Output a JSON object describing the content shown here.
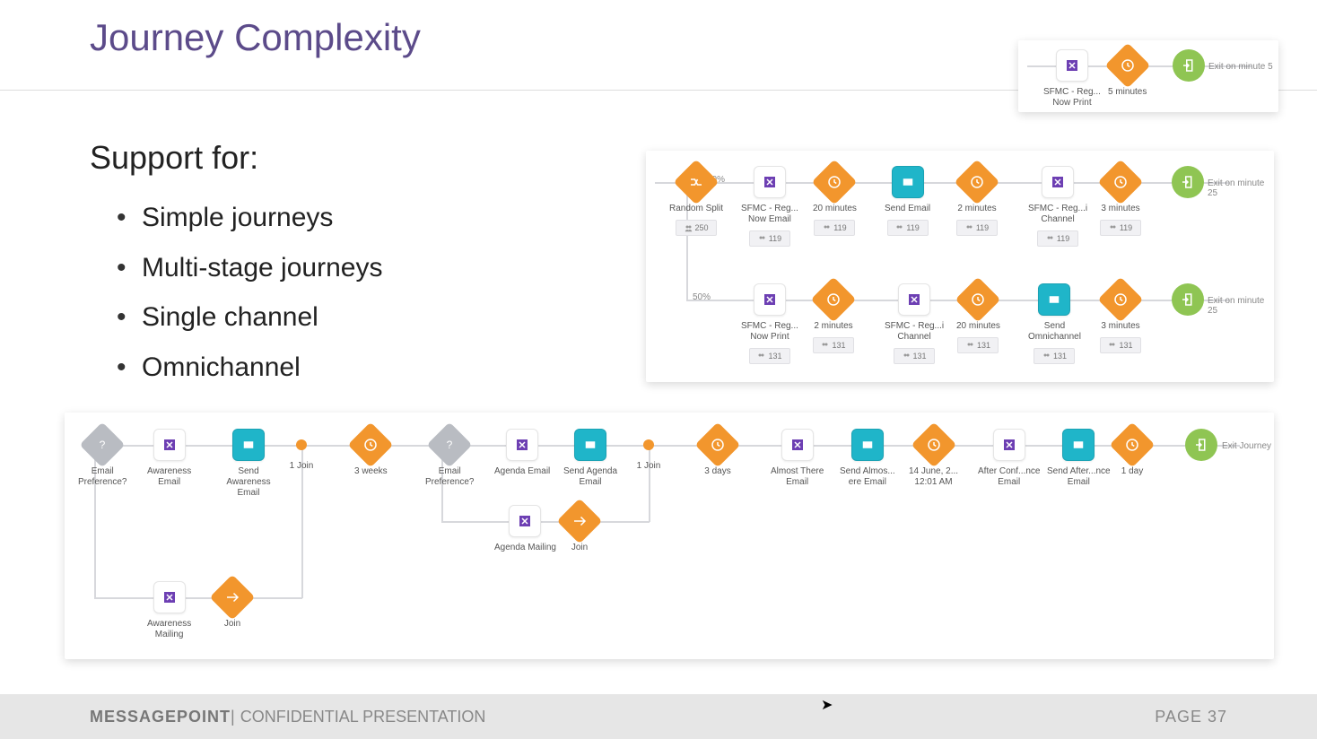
{
  "title": "Journey Complexity",
  "support_heading": "Support for:",
  "bullets": [
    "Simple journeys",
    "Multi-stage journeys",
    "Single channel",
    "Omnichannel"
  ],
  "footer": {
    "brand": "MESSAGEPOINT",
    "separator": " | ",
    "conf": "CONFIDENTIAL PRESENTATION",
    "page": "PAGE  37"
  },
  "panel1": {
    "n1": {
      "label": "SFMC - Reg...\nNow Print"
    },
    "n2": {
      "label": "5 minutes"
    },
    "n3": {
      "side": "Exit on minute 5"
    }
  },
  "panel2": {
    "percent_top": "50%",
    "percent_bot": "50%",
    "rowA": [
      {
        "label": "Random Split",
        "badge": "250"
      },
      {
        "label": "SFMC - Reg...\nNow Email",
        "badge": "119"
      },
      {
        "label": "20 minutes",
        "badge": "119"
      },
      {
        "label": "Send Email",
        "badge": "119"
      },
      {
        "label": "2 minutes",
        "badge": "119"
      },
      {
        "label": "SFMC - Reg...i\nChannel",
        "badge": "119"
      },
      {
        "label": "3 minutes",
        "badge": "119"
      },
      {
        "side": "Exit on minute 25"
      }
    ],
    "rowB": [
      {
        "label": "SFMC - Reg...\nNow Print",
        "badge": "131"
      },
      {
        "label": "2 minutes",
        "badge": "131"
      },
      {
        "label": "SFMC - Reg...i\nChannel",
        "badge": "131"
      },
      {
        "label": "20 minutes",
        "badge": "131"
      },
      {
        "label": "Send\nOmnichannel",
        "badge": "131"
      },
      {
        "label": "3 minutes",
        "badge": "131"
      },
      {
        "side": "Exit on minute 25"
      }
    ]
  },
  "panel3": {
    "row": [
      {
        "label": "Email\nPreference?"
      },
      {
        "label": "Awareness\nEmail"
      },
      {
        "label": "Send Awareness\nEmail"
      },
      {
        "label": "1 Join"
      },
      {
        "label": "3 weeks"
      },
      {
        "label": "Email\nPreference?"
      },
      {
        "label": "Agenda Email"
      },
      {
        "label": "Send Agenda\nEmail"
      },
      {
        "label": "1 Join"
      },
      {
        "label": "3 days"
      },
      {
        "label": "Almost There\nEmail"
      },
      {
        "label": "Send Almos...\nere Email"
      },
      {
        "label": "14 June, 2...\n12:01 AM"
      },
      {
        "label": "After Conf...nce\nEmail"
      },
      {
        "label": "Send After...nce\nEmail"
      },
      {
        "label": "1 day"
      },
      {
        "side": "Exit Journey"
      }
    ],
    "branch1": [
      {
        "label": "Awareness\nMailing"
      },
      {
        "label": "Join"
      }
    ],
    "branch2": [
      {
        "label": "Agenda Mailing"
      },
      {
        "label": "Join"
      }
    ]
  }
}
